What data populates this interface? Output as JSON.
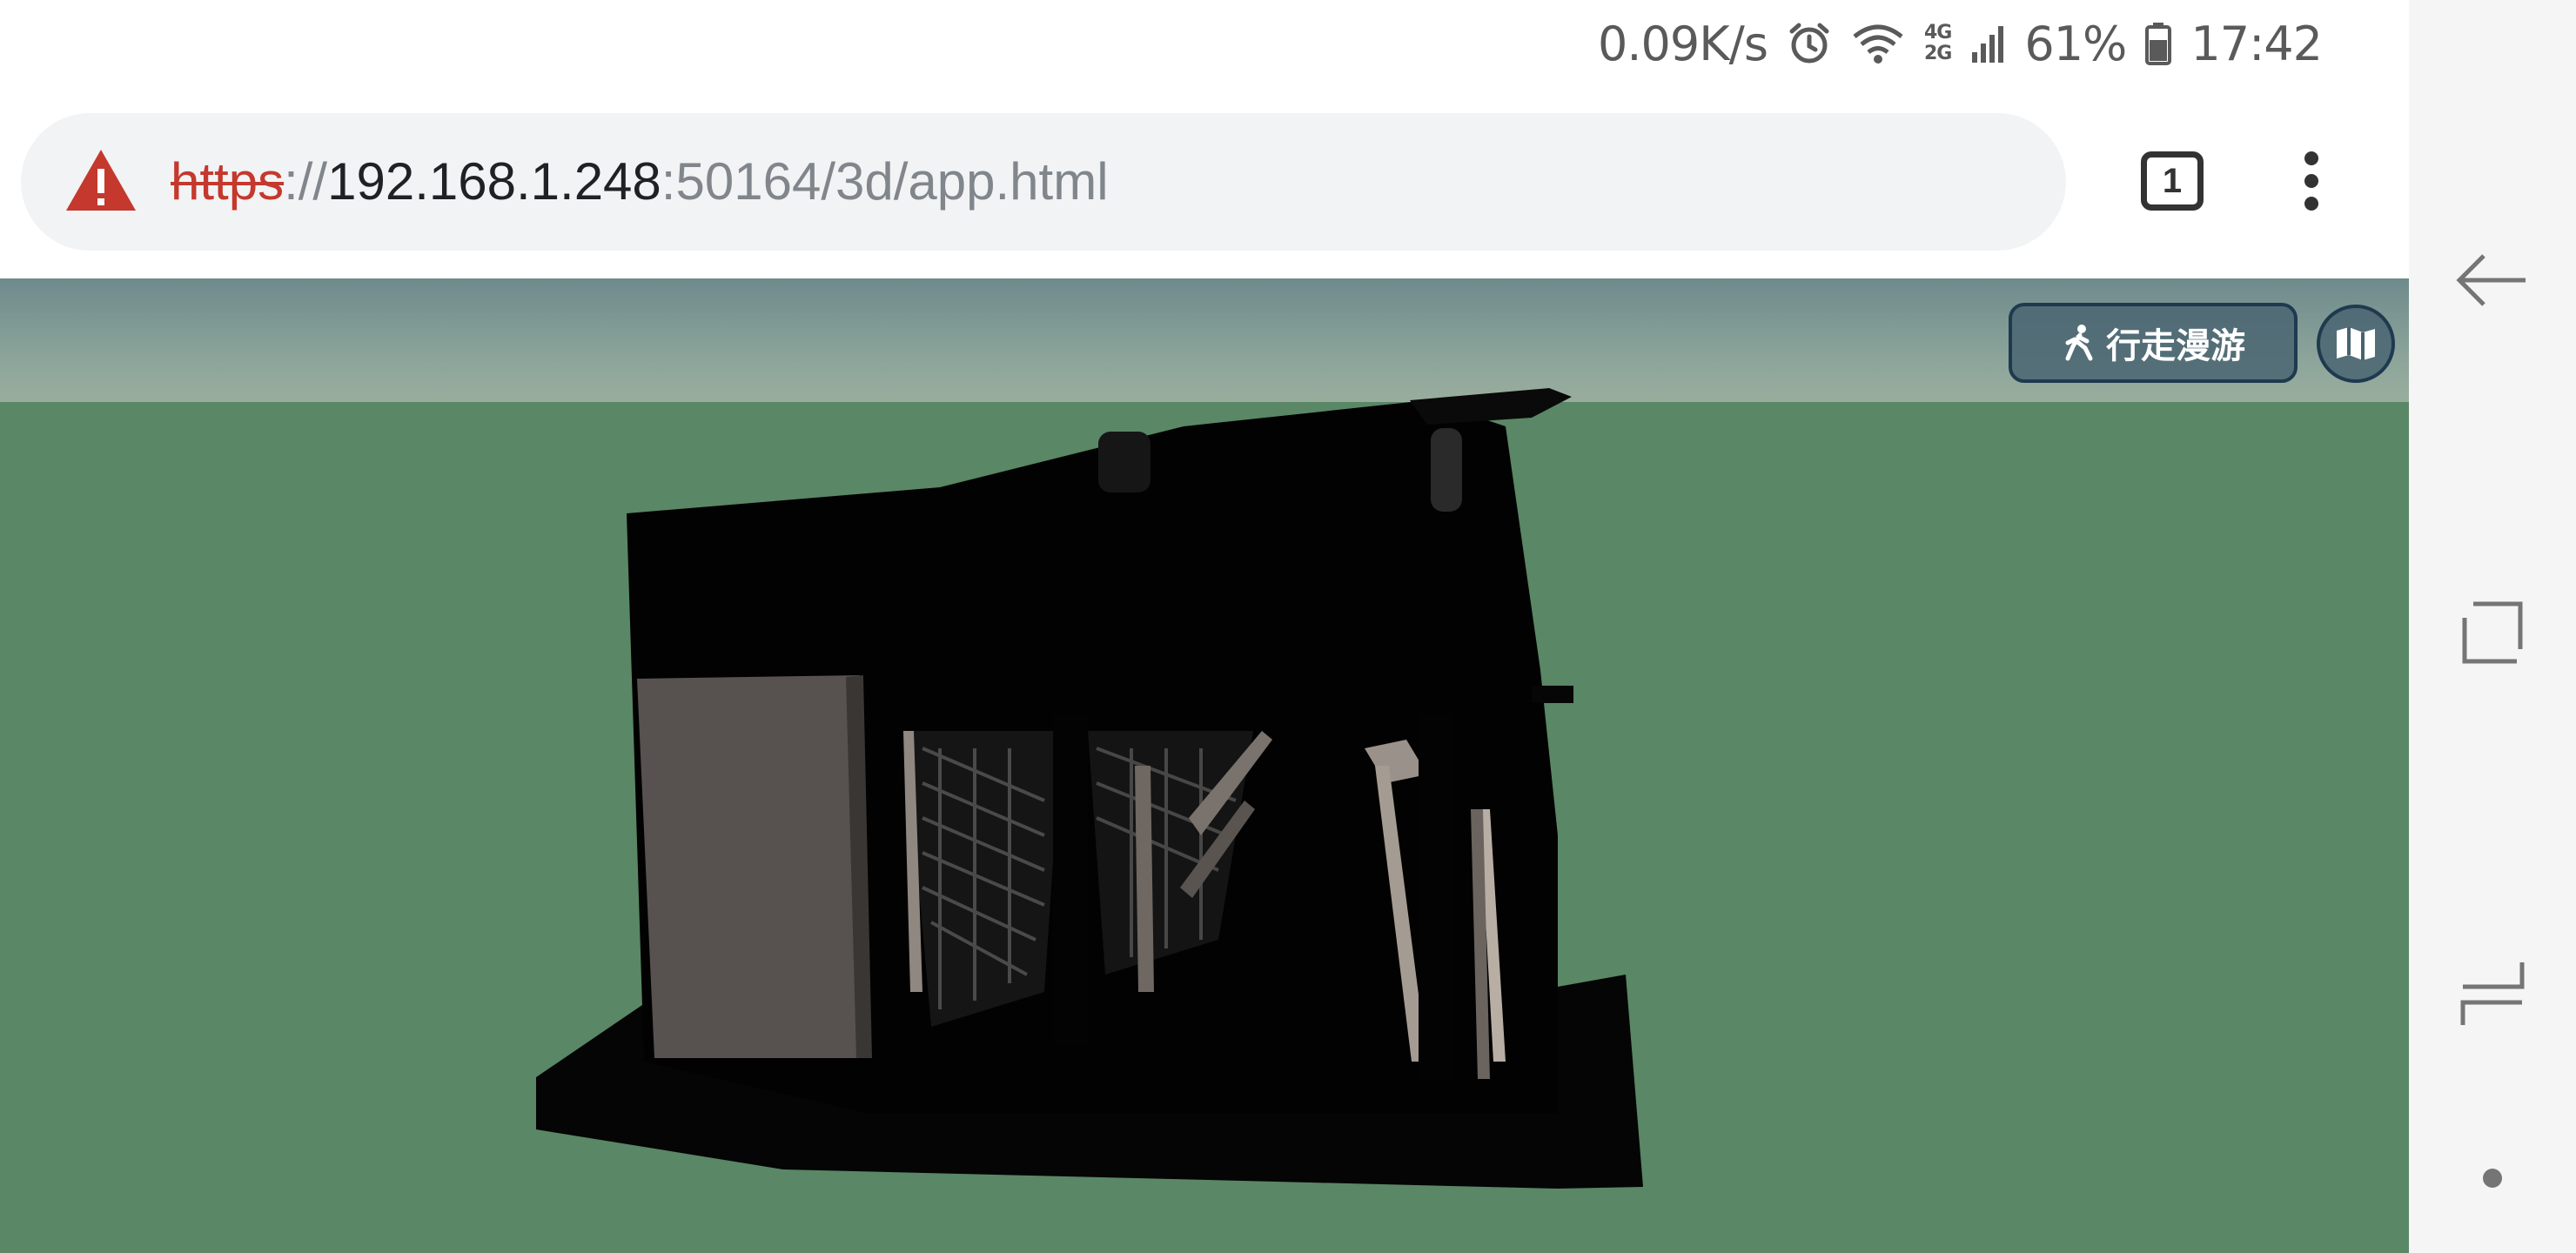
{
  "status_bar": {
    "net_speed": "0.09K/s",
    "network_type_top": "4G",
    "network_type_bottom": "2G",
    "battery_percent": "61%",
    "time": "17:42",
    "icons": [
      "alarm-icon",
      "wifi-icon",
      "signal-icon",
      "battery-icon"
    ]
  },
  "browser": {
    "url_scheme": "https",
    "url_separator": "://",
    "url_host": "192.168.1.248",
    "url_rest": ":50164/3d/app.html",
    "tab_count": "1",
    "security": "not-secure"
  },
  "viewport": {
    "walk_mode_label": "行走漫游",
    "walk_mode_icon": "walking-person-icon",
    "map_icon": "map-icon",
    "colors": {
      "ground": "#5a8766",
      "sky": "#8ea69b",
      "button_bg": "#486370",
      "button_border": "#1f3a4f"
    }
  },
  "navigation_bar": {
    "buttons": [
      "back-icon",
      "recents-icon",
      "home-icon",
      "dot-icon"
    ]
  }
}
